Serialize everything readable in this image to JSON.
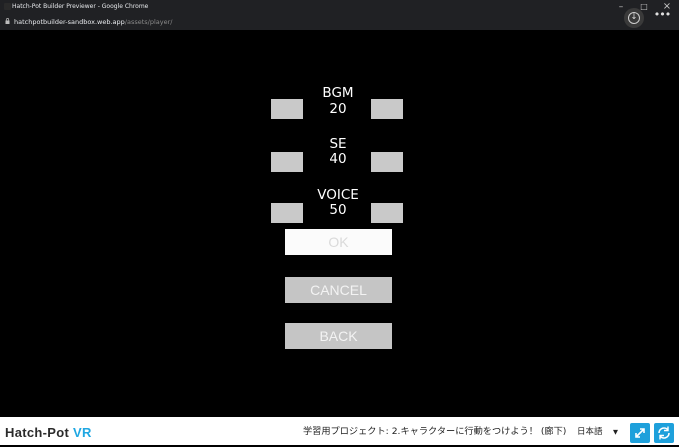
{
  "window": {
    "title": "Hatch-Pot Builder Previewer - Google Chrome",
    "minimize": "–",
    "maximize": "□",
    "close": "×"
  },
  "address": {
    "host": "hatchpotbuilder-sandbox.web.app",
    "path": "/assets/player/"
  },
  "toolbar": {
    "download_icon": "download-icon",
    "more_icon": "more-horizontal-icon"
  },
  "settings": {
    "bgm": {
      "label": "BGM",
      "value": "20"
    },
    "se": {
      "label": "SE",
      "value": "40"
    },
    "voice": {
      "label": "VOICE",
      "value": "50"
    }
  },
  "actions": {
    "ok": "OK",
    "cancel": "CANCEL",
    "back": "BACK"
  },
  "footer": {
    "brand_main": "Hatch-Pot",
    "brand_accent": "VR",
    "project": "学習用プロジェクト: 2.キャラクターに行動をつけよう！ (廊下)",
    "language": "日本語",
    "caret": "▼"
  },
  "colors": {
    "accent": "#1ea0db",
    "button_grey": "#c5c5c5",
    "ok_button": "#fbfbfb",
    "background": "#000000"
  }
}
